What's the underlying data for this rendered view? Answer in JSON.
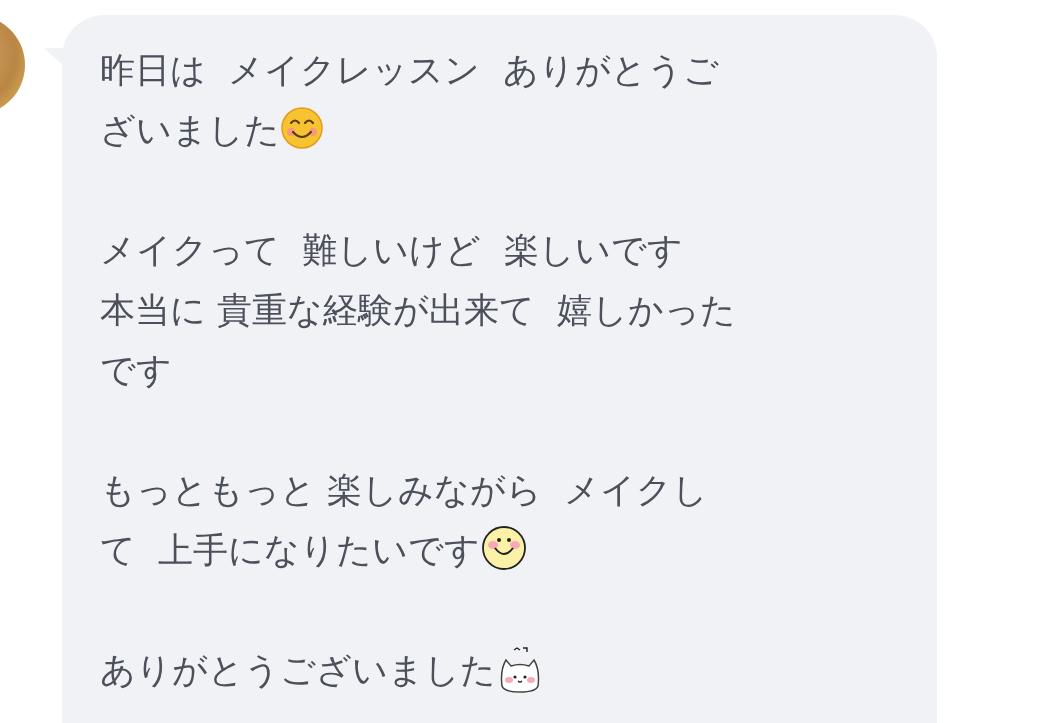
{
  "message": {
    "paragraphs": [
      {
        "lines": [
          "昨日は  メイクレッスン  ありがとうご",
          "ざいました"
        ],
        "kind": "blush"
      },
      {
        "lines": [
          "メイクって  難しいけど  楽しいです",
          "本当に 貴重な経験が出来て  嬉しかった",
          "です"
        ]
      },
      {
        "lines": [
          "もっともっと 楽しみながら  メイクし",
          "て  上手になりたいです"
        ],
        "kind": "smiley"
      },
      {
        "lines": [
          "ありがとうございました"
        ],
        "kind": "cat"
      }
    ]
  }
}
